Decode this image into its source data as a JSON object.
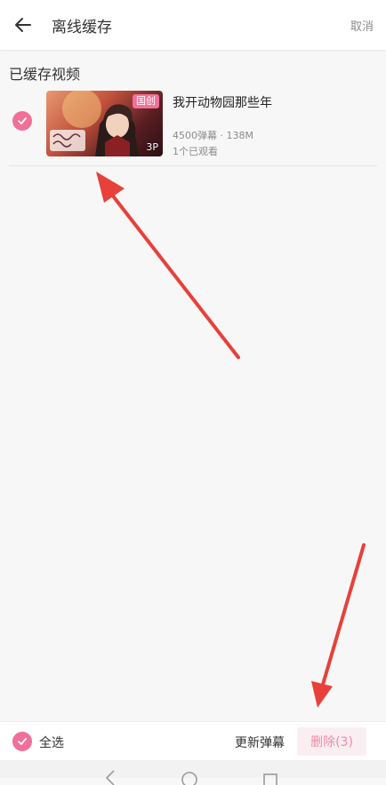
{
  "header": {
    "title": "离线缓存",
    "cancel_label": "取消"
  },
  "section": {
    "title": "已缓存视频"
  },
  "videos": [
    {
      "title": "我开动物园那些年",
      "badge": "国创",
      "parts": "3P",
      "meta": "4500弹幕 · 138M",
      "watched": "1个已观看",
      "selected": true
    }
  ],
  "bottom_bar": {
    "select_all_label": "全选",
    "update_danmaku_label": "更新弹幕",
    "delete_label": "删除(3)"
  },
  "colors": {
    "accent": "#f0709a",
    "arrow": "#e8403a"
  }
}
